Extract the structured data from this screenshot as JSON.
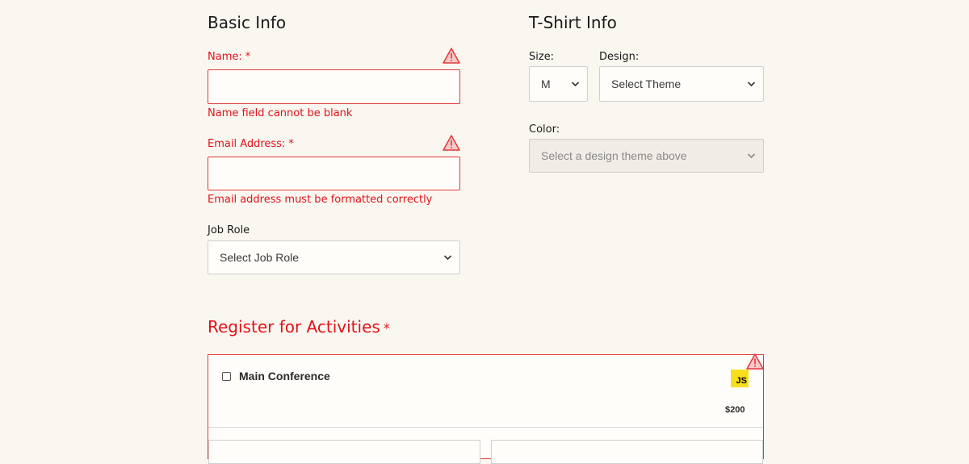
{
  "basic_info": {
    "heading": "Basic Info",
    "name": {
      "label": "Name:",
      "required_mark": "*",
      "value": "",
      "error": "Name field cannot be blank"
    },
    "email": {
      "label": "Email Address:",
      "required_mark": "*",
      "value": "",
      "error": "Email address must be formatted correctly"
    },
    "job_role": {
      "label": "Job Role",
      "selected": "Select Job Role"
    }
  },
  "tshirt_info": {
    "heading": "T-Shirt Info",
    "size": {
      "label": "Size:",
      "selected": "M"
    },
    "design": {
      "label": "Design:",
      "selected": "Select Theme"
    },
    "color": {
      "label": "Color:",
      "selected": "Select a design theme above"
    }
  },
  "activities": {
    "heading": "Register for Activities",
    "required_mark": "*",
    "items": [
      {
        "label": "Main Conference",
        "badge": "JS",
        "price": "$200",
        "checked": false
      }
    ]
  },
  "colors": {
    "error": "#e0131a",
    "background": "#faf6f0",
    "js_badge": "#f7df1e"
  },
  "icons": {
    "warning": "warning-triangle-icon",
    "chevron": "chevron-down-icon"
  }
}
